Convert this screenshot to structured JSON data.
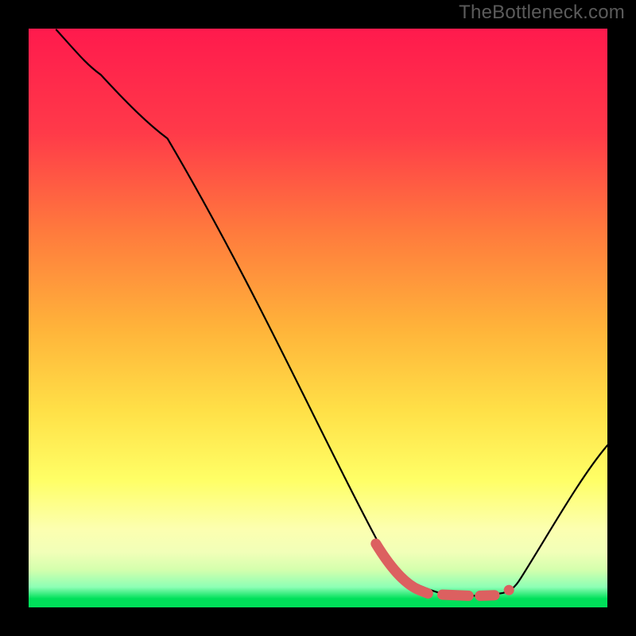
{
  "watermark": "TheBottleneck.com",
  "colors": {
    "bg_black": "#000000",
    "grad_top": "#ff1a4d",
    "grad_mid1": "#ff7f3a",
    "grad_mid2": "#ffd23a",
    "grad_mid3": "#ffff66",
    "grad_band1": "#eaff80",
    "grad_band2": "#b6ffab",
    "grad_bottom": "#00e05a",
    "curve": "#000000",
    "red_path": "#dc6060",
    "watermark": "#5b5b5b"
  },
  "chart_data": {
    "type": "line",
    "title": "",
    "xlabel": "",
    "ylabel": "",
    "xlim": [
      0,
      100
    ],
    "ylim": [
      0,
      100
    ],
    "series": [
      {
        "name": "bottleneck-curve",
        "x": [
          4.8,
          12.5,
          24,
          60,
          67,
          71,
          77,
          82,
          85,
          100
        ],
        "y": [
          99.8,
          92.0,
          81,
          12,
          4,
          2.5,
          2.0,
          2.5,
          5,
          28
        ]
      },
      {
        "name": "red-bumps",
        "segments": [
          {
            "x": [
              60.0,
              67.5,
              69.0
            ],
            "y": [
              11.0,
              3.0,
              2.4
            ]
          },
          {
            "x": [
              71.5,
              76.0
            ],
            "y": [
              2.2,
              2.0
            ]
          },
          {
            "x": [
              78.0,
              80.5
            ],
            "y": [
              2.0,
              2.1
            ]
          }
        ],
        "dot": {
          "x": 83.0,
          "y": 3.0
        }
      }
    ],
    "note": "Values are approximate readings from the pixel layout; y is 0 at bottom, 100 at top."
  }
}
